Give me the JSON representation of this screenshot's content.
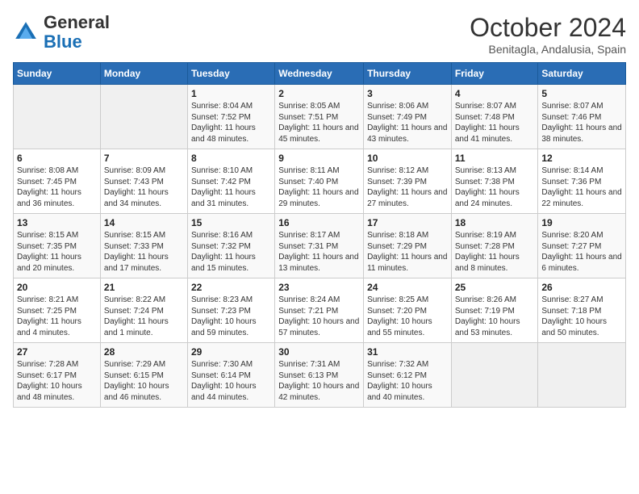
{
  "header": {
    "logo_general": "General",
    "logo_blue": "Blue",
    "month": "October 2024",
    "location": "Benitagla, Andalusia, Spain"
  },
  "weekdays": [
    "Sunday",
    "Monday",
    "Tuesday",
    "Wednesday",
    "Thursday",
    "Friday",
    "Saturday"
  ],
  "weeks": [
    [
      {
        "day": "",
        "info": ""
      },
      {
        "day": "",
        "info": ""
      },
      {
        "day": "1",
        "info": "Sunrise: 8:04 AM\nSunset: 7:52 PM\nDaylight: 11 hours and 48 minutes."
      },
      {
        "day": "2",
        "info": "Sunrise: 8:05 AM\nSunset: 7:51 PM\nDaylight: 11 hours and 45 minutes."
      },
      {
        "day": "3",
        "info": "Sunrise: 8:06 AM\nSunset: 7:49 PM\nDaylight: 11 hours and 43 minutes."
      },
      {
        "day": "4",
        "info": "Sunrise: 8:07 AM\nSunset: 7:48 PM\nDaylight: 11 hours and 41 minutes."
      },
      {
        "day": "5",
        "info": "Sunrise: 8:07 AM\nSunset: 7:46 PM\nDaylight: 11 hours and 38 minutes."
      }
    ],
    [
      {
        "day": "6",
        "info": "Sunrise: 8:08 AM\nSunset: 7:45 PM\nDaylight: 11 hours and 36 minutes."
      },
      {
        "day": "7",
        "info": "Sunrise: 8:09 AM\nSunset: 7:43 PM\nDaylight: 11 hours and 34 minutes."
      },
      {
        "day": "8",
        "info": "Sunrise: 8:10 AM\nSunset: 7:42 PM\nDaylight: 11 hours and 31 minutes."
      },
      {
        "day": "9",
        "info": "Sunrise: 8:11 AM\nSunset: 7:40 PM\nDaylight: 11 hours and 29 minutes."
      },
      {
        "day": "10",
        "info": "Sunrise: 8:12 AM\nSunset: 7:39 PM\nDaylight: 11 hours and 27 minutes."
      },
      {
        "day": "11",
        "info": "Sunrise: 8:13 AM\nSunset: 7:38 PM\nDaylight: 11 hours and 24 minutes."
      },
      {
        "day": "12",
        "info": "Sunrise: 8:14 AM\nSunset: 7:36 PM\nDaylight: 11 hours and 22 minutes."
      }
    ],
    [
      {
        "day": "13",
        "info": "Sunrise: 8:15 AM\nSunset: 7:35 PM\nDaylight: 11 hours and 20 minutes."
      },
      {
        "day": "14",
        "info": "Sunrise: 8:15 AM\nSunset: 7:33 PM\nDaylight: 11 hours and 17 minutes."
      },
      {
        "day": "15",
        "info": "Sunrise: 8:16 AM\nSunset: 7:32 PM\nDaylight: 11 hours and 15 minutes."
      },
      {
        "day": "16",
        "info": "Sunrise: 8:17 AM\nSunset: 7:31 PM\nDaylight: 11 hours and 13 minutes."
      },
      {
        "day": "17",
        "info": "Sunrise: 8:18 AM\nSunset: 7:29 PM\nDaylight: 11 hours and 11 minutes."
      },
      {
        "day": "18",
        "info": "Sunrise: 8:19 AM\nSunset: 7:28 PM\nDaylight: 11 hours and 8 minutes."
      },
      {
        "day": "19",
        "info": "Sunrise: 8:20 AM\nSunset: 7:27 PM\nDaylight: 11 hours and 6 minutes."
      }
    ],
    [
      {
        "day": "20",
        "info": "Sunrise: 8:21 AM\nSunset: 7:25 PM\nDaylight: 11 hours and 4 minutes."
      },
      {
        "day": "21",
        "info": "Sunrise: 8:22 AM\nSunset: 7:24 PM\nDaylight: 11 hours and 1 minute."
      },
      {
        "day": "22",
        "info": "Sunrise: 8:23 AM\nSunset: 7:23 PM\nDaylight: 10 hours and 59 minutes."
      },
      {
        "day": "23",
        "info": "Sunrise: 8:24 AM\nSunset: 7:21 PM\nDaylight: 10 hours and 57 minutes."
      },
      {
        "day": "24",
        "info": "Sunrise: 8:25 AM\nSunset: 7:20 PM\nDaylight: 10 hours and 55 minutes."
      },
      {
        "day": "25",
        "info": "Sunrise: 8:26 AM\nSunset: 7:19 PM\nDaylight: 10 hours and 53 minutes."
      },
      {
        "day": "26",
        "info": "Sunrise: 8:27 AM\nSunset: 7:18 PM\nDaylight: 10 hours and 50 minutes."
      }
    ],
    [
      {
        "day": "27",
        "info": "Sunrise: 7:28 AM\nSunset: 6:17 PM\nDaylight: 10 hours and 48 minutes."
      },
      {
        "day": "28",
        "info": "Sunrise: 7:29 AM\nSunset: 6:15 PM\nDaylight: 10 hours and 46 minutes."
      },
      {
        "day": "29",
        "info": "Sunrise: 7:30 AM\nSunset: 6:14 PM\nDaylight: 10 hours and 44 minutes."
      },
      {
        "day": "30",
        "info": "Sunrise: 7:31 AM\nSunset: 6:13 PM\nDaylight: 10 hours and 42 minutes."
      },
      {
        "day": "31",
        "info": "Sunrise: 7:32 AM\nSunset: 6:12 PM\nDaylight: 10 hours and 40 minutes."
      },
      {
        "day": "",
        "info": ""
      },
      {
        "day": "",
        "info": ""
      }
    ]
  ]
}
